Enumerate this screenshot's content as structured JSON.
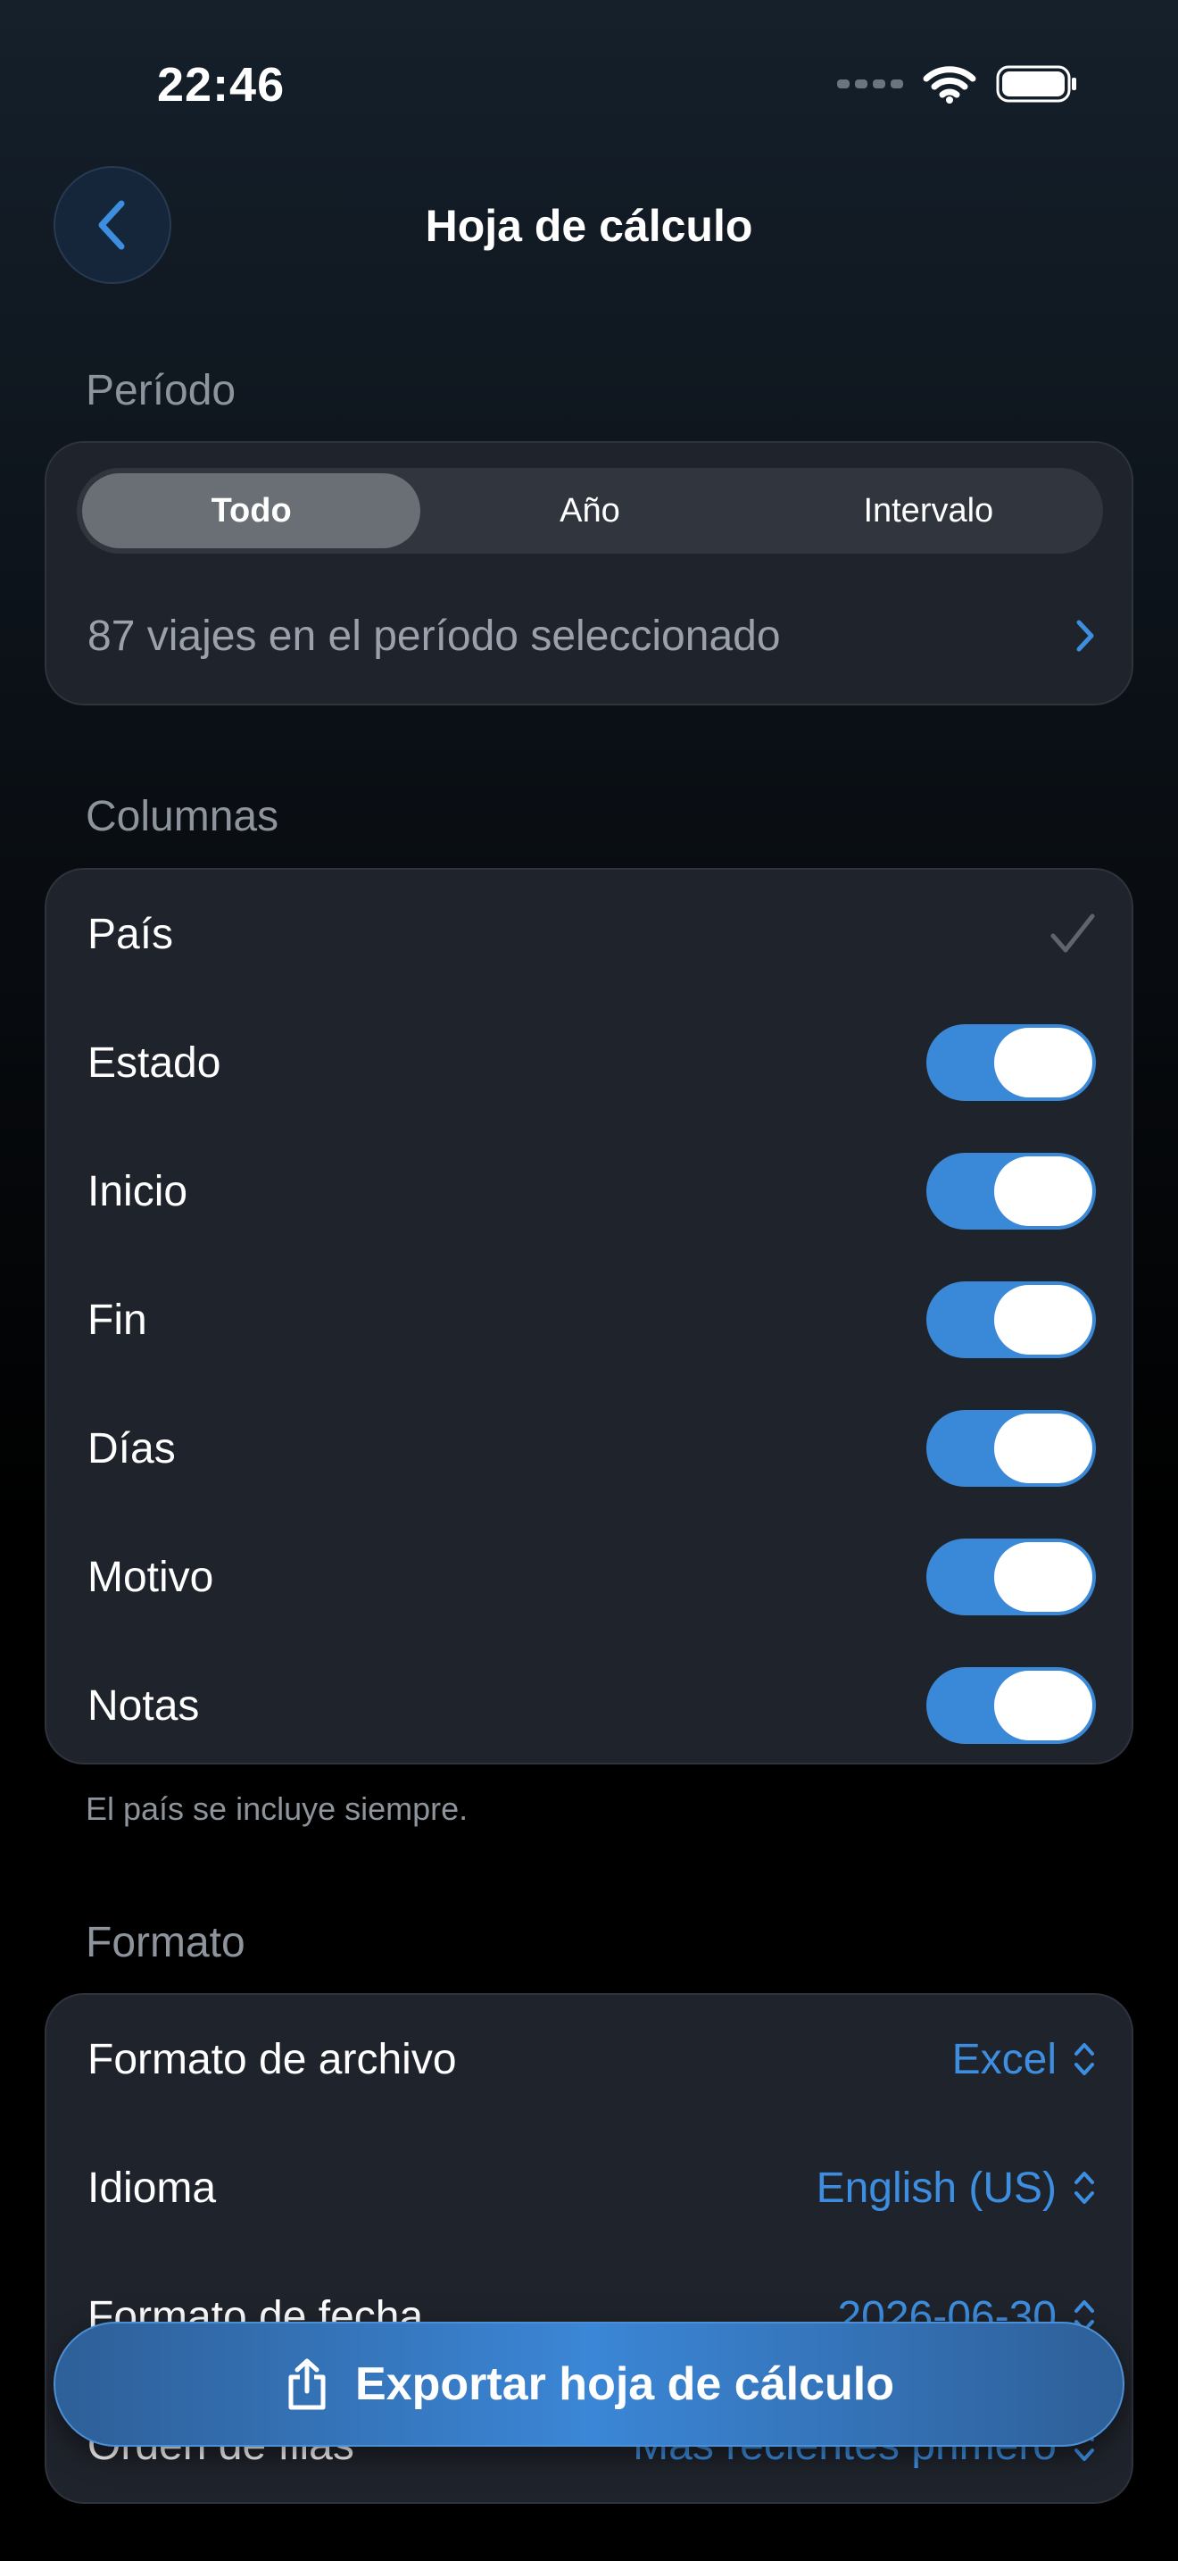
{
  "status_bar": {
    "time": "22:46"
  },
  "nav": {
    "title": "Hoja de cálculo"
  },
  "period": {
    "header": "Período",
    "segments": [
      {
        "label": "Todo",
        "selected": true
      },
      {
        "label": "Año",
        "selected": false
      },
      {
        "label": "Intervalo",
        "selected": false
      }
    ],
    "summary": "87 viajes en el período seleccionado"
  },
  "columns": {
    "header": "Columnas",
    "items": [
      {
        "label": "País",
        "control": "checkmark",
        "checked": true
      },
      {
        "label": "Estado",
        "control": "toggle",
        "on": true
      },
      {
        "label": "Inicio",
        "control": "toggle",
        "on": true
      },
      {
        "label": "Fin",
        "control": "toggle",
        "on": true
      },
      {
        "label": "Días",
        "control": "toggle",
        "on": true
      },
      {
        "label": "Motivo",
        "control": "toggle",
        "on": true
      },
      {
        "label": "Notas",
        "control": "toggle",
        "on": true
      }
    ],
    "footnote": "El país se incluye siempre."
  },
  "format": {
    "header": "Formato",
    "items": [
      {
        "label": "Formato de archivo",
        "value": "Excel"
      },
      {
        "label": "Idioma",
        "value": "English (US)"
      },
      {
        "label": "Formato de fecha",
        "value": "2026-06-30"
      },
      {
        "label": "Orden de filas",
        "value": "Más recientes primero"
      }
    ]
  },
  "export_button": {
    "label": "Exportar hoja de cálculo"
  },
  "colors": {
    "accent": "#3a88d8",
    "card": "#1f232b",
    "secondary_text": "#8d949c"
  }
}
